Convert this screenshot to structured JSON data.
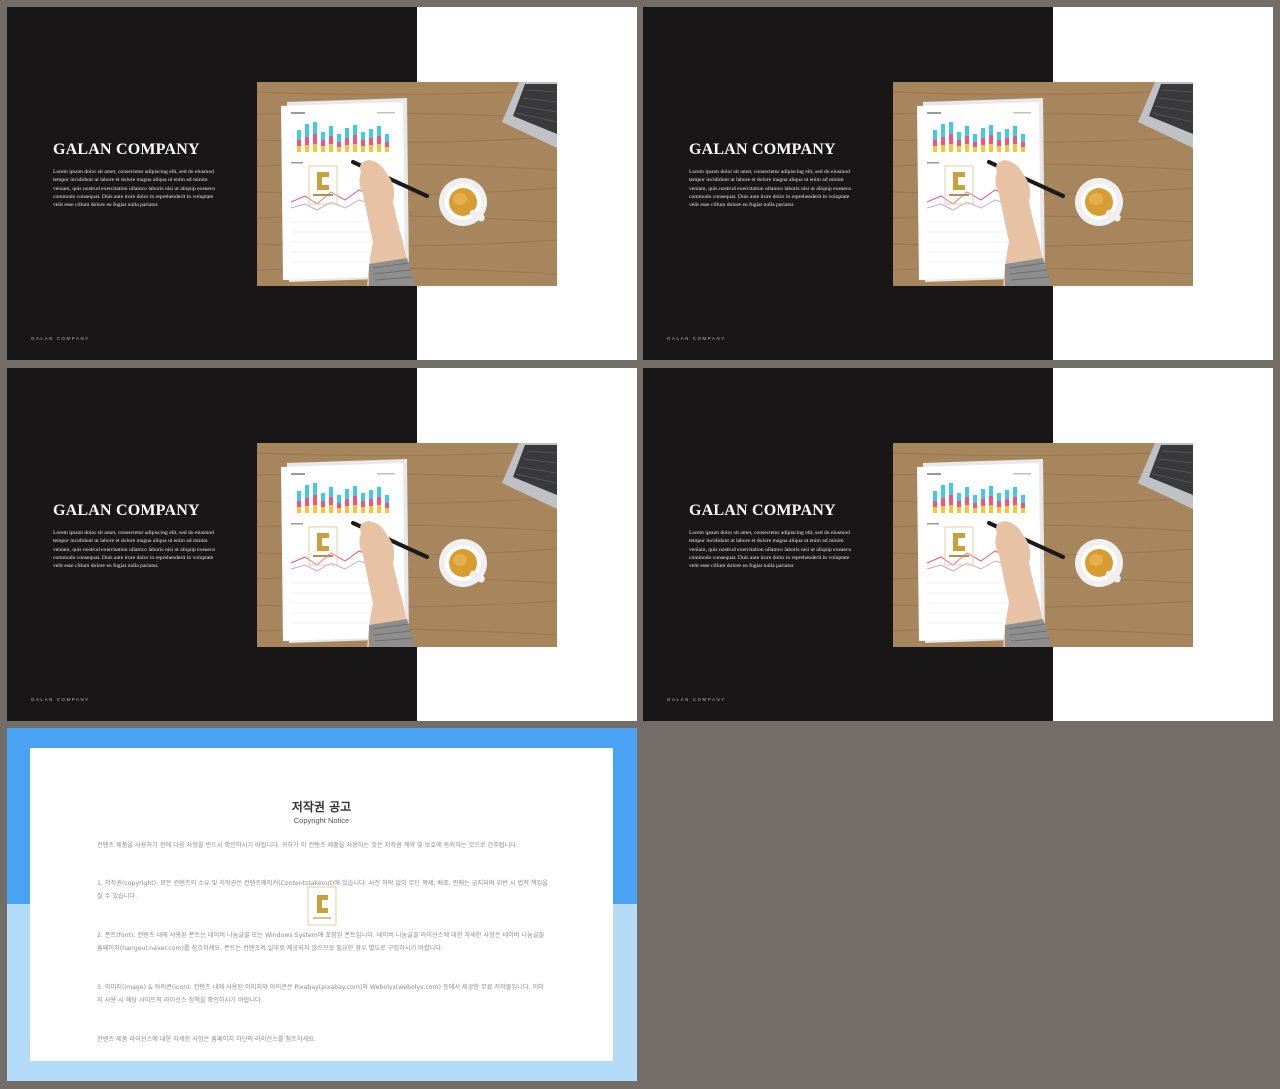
{
  "slides": [
    {
      "title": "GALAN COMPANY",
      "body": "Lorem ipsum dolor sit amet, consectetur adipiscing elit, sed do eiusmod tempor incididunt ut labore et dolore magna aliqua ut enim ad minim veniam, quis nostrud exercitation ullamco laboris nisi ut aliquip exeaeco commodo consequat. Duis aute irure dolor in reprehenderit in voluptate velit esse cillum dolore eu fugiat nulla pariatur.",
      "footer": "GALAN COMPANY"
    },
    {
      "title": "GALAN COMPANY",
      "body": "Lorem ipsum dolor sit amet, consectetur adipiscing elit, sed do eiusmod tempor incididunt ut labore et dolore magna aliqua ut enim ad minim veniam, quis nostrud exercitation ullamco laboris nisi ut aliquip exeaeco commodo consequat. Duis aute irure dolor in reprehenderit in voluptate velit esse cillum dolore eu fugiat nulla pariatur.",
      "footer": "GALAN COMPANY"
    },
    {
      "title": "GALAN COMPANY",
      "body": "Lorem ipsum dolor sit amet, consectetur adipiscing elit, sed do eiusmod tempor incididunt ut labore et dolore magna aliqua ut enim ad minim veniam, quis nostrud exercitation ullamco laboris nisi ut aliquip exeaeco commodo consequat. Duis aute irure dolor in reprehenderit in voluptate velit esse cillum dolore eu fugiat nulla pariatur.",
      "footer": "GALAN COMPANY"
    },
    {
      "title": "GALAN COMPANY",
      "body": "Lorem ipsum dolor sit amet, consectetur adipiscing elit, sed do eiusmod tempor incididunt ut labore et dolore magna aliqua ut enim ad minim veniam, quis nostrud exercitation ullamco laboris nisi ut aliquip exeaeco commodo consequat. Duis aute irure dolor in reprehenderit in voluptate velit esse cillum dolore eu fugiat nulla pariatur.",
      "footer": "GALAN COMPANY"
    }
  ],
  "copyright": {
    "title": "저작권 공고",
    "subtitle": "Copyright Notice",
    "paragraphs": [
      "컨텐츠 제품을 사용하기 전에 다음 사항을 반드시 확인하시기 바랍니다. 귀하가 이 컨텐츠 제품을 사용하는 것은 저작권 계약 및 보호에 동의하는 것으로 간주됩니다.",
      "1. 저작권(copyright): 모든 컨텐츠의 소유 및 저작권은 컨텐츠메이커(Contentstakeout)에 있습니다. 사전 허락 없이 무단 복제, 배포, 판매는 금지되며 위반 시 법적 책임을 질 수 있습니다.",
      "2. 폰트(font): 컨텐츠 내에 사용된 폰트는 네이버 나눔글꼴 또는 Windows System에 포함된 폰트입니다. 네이버 나눔글꼴 라이선스에 대한 자세한 사항은 네이버 나눔글꼴 홈페이지(hangeul.naver.com)를 참조하세요. 폰트는 컨텐츠의 일부로 제공되지 않으므로 필요한 경우 별도로 구입하시기 바랍니다.",
      "3. 이미지(image) & 아이콘(icon): 컨텐츠 내에 사용된 이미지와 아이콘은 Pixabay(pixabay.com)와 Webolys(webolys.com) 등에서 제공한 무료 저작물입니다. 이미지 사용 시 해당 사이트의 라이선스 정책을 확인하시기 바랍니다.",
      "컨텐츠 제품 라이선스에 대한 자세한 사항은 홈페이지 하단의 라이선스를 참조하세요."
    ]
  },
  "colors": {
    "background": "#736d67",
    "dark_panel": "#181617",
    "copyright_blue": "#4aa3f2",
    "copyright_light_blue": "#b4dcf9",
    "chart_bar_blue": "#43c8e8",
    "chart_bar_pink": "#f0557a",
    "chart_bar_yellow": "#f7c43b",
    "watermark_gold": "#c9a03c"
  },
  "icons": [
    "chart-document-image",
    "coffee-cup-image",
    "laptop-image",
    "hand-with-pen-image",
    "logo-watermark"
  ]
}
